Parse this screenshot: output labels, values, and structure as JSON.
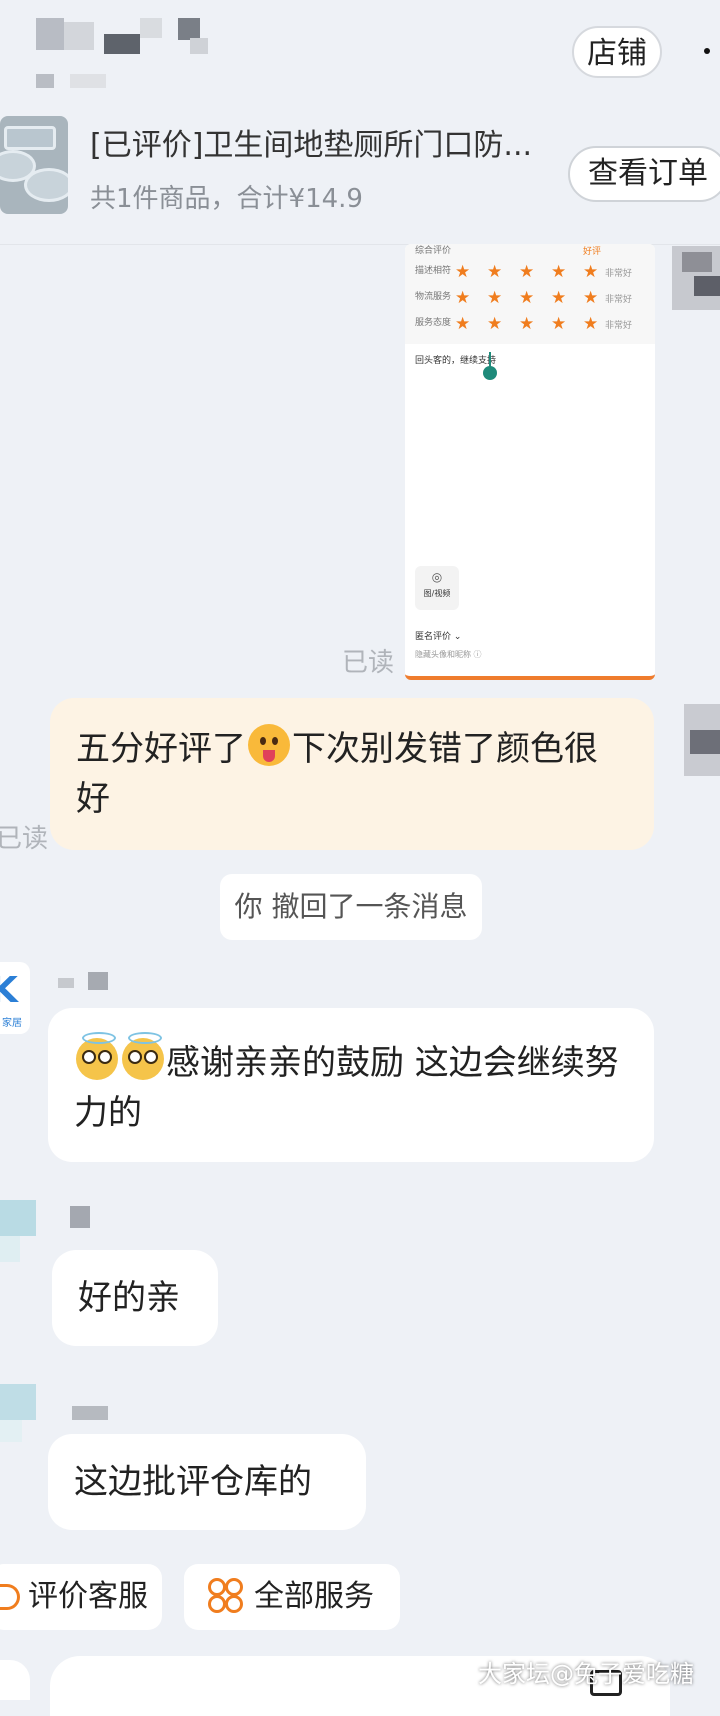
{
  "header": {
    "store_button": "店铺"
  },
  "order": {
    "title": "[已评价]卫生间地垫厕所门口防...",
    "summary": "共1件商品，合计¥14.9",
    "view_button": "查看订单"
  },
  "review_shot": {
    "rows": [
      {
        "label": "描述相符",
        "stars": 5,
        "tag": "非常好"
      },
      {
        "label": "物流服务",
        "stars": 5,
        "tag": "非常好"
      },
      {
        "label": "服务态度",
        "stars": 5,
        "tag": "非常好"
      }
    ],
    "top_label": "综合评价",
    "top_tag": "好评",
    "text": "回头客的，继续支持",
    "media_label": "图/视频",
    "anon_label": "匿名评价 ⌄",
    "anon_sub": "隐藏头像和昵称 ⓘ"
  },
  "read_label_1": "已读",
  "read_label_2": "已读",
  "messages": {
    "self_before": "五分好评了",
    "self_after": "下次别发错了颜色很好",
    "recall": "你 撤回了一条消息",
    "reply": "感谢亲亲的鼓励  这边会继续努力的",
    "short1": "好的亲",
    "short2": "这边批评仓库的"
  },
  "avatar_text": "K",
  "avatar_sub": "家居",
  "services": {
    "rate": "评价客服",
    "all": "全部服务"
  },
  "watermark": "大家坛@兔子爱吃糖"
}
